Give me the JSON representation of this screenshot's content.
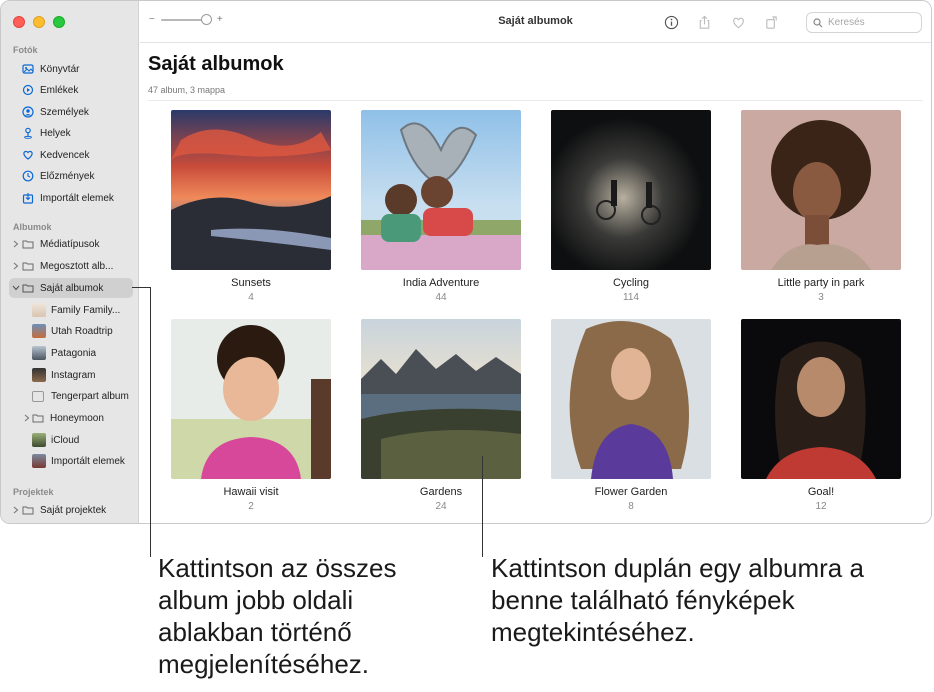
{
  "window": {
    "title": "Saját albumok",
    "search_placeholder": "Keresés",
    "zoom_minus": "−",
    "zoom_plus": "+"
  },
  "sidebar": {
    "section_photos": "Fotók",
    "photos_items": [
      {
        "label": "Könyvtár",
        "icon": "library-icon"
      },
      {
        "label": "Emlékek",
        "icon": "memories-icon"
      },
      {
        "label": "Személyek",
        "icon": "people-icon"
      },
      {
        "label": "Helyek",
        "icon": "places-icon"
      },
      {
        "label": "Kedvencek",
        "icon": "heart-icon"
      },
      {
        "label": "Előzmények",
        "icon": "clock-icon"
      },
      {
        "label": "Importált elemek",
        "icon": "import-icon"
      }
    ],
    "section_albums": "Albumok",
    "album_groups": [
      {
        "label": "Médiatípusok"
      },
      {
        "label": "Megosztott alb..."
      },
      {
        "label": "Saját albumok"
      }
    ],
    "my_albums": [
      {
        "label": "Family Family..."
      },
      {
        "label": "Utah Roadtrip"
      },
      {
        "label": "Patagonia"
      },
      {
        "label": "Instagram"
      },
      {
        "label": "Tengerpart album"
      },
      {
        "label": "Honeymoon"
      },
      {
        "label": "iCloud"
      },
      {
        "label": "Importált elemek"
      }
    ],
    "section_projects": "Projektek",
    "projects_item": "Saját projektek"
  },
  "main": {
    "title": "Saját albumok",
    "subtitle": "47 album, 3 mappa",
    "albums": [
      {
        "name": "Sunsets",
        "count": "4"
      },
      {
        "name": "India Adventure",
        "count": "44"
      },
      {
        "name": "Cycling",
        "count": "114"
      },
      {
        "name": "Little party in park",
        "count": "3"
      },
      {
        "name": "Hawaii visit",
        "count": "2"
      },
      {
        "name": "Gardens",
        "count": "24"
      },
      {
        "name": "Flower Garden",
        "count": "8"
      },
      {
        "name": "Goal!",
        "count": "12"
      }
    ]
  },
  "callouts": {
    "left": "Kattintson az összes album jobb oldali ablakban történő megjelenítéséhez.",
    "right": "Kattintson duplán egy albumra a benne található fényképek megtekintéséhez."
  },
  "colors": {
    "accent": "#0a68d6",
    "sidebar_bg": "#e6e6e6",
    "selected_bg": "#d0d0d0"
  }
}
